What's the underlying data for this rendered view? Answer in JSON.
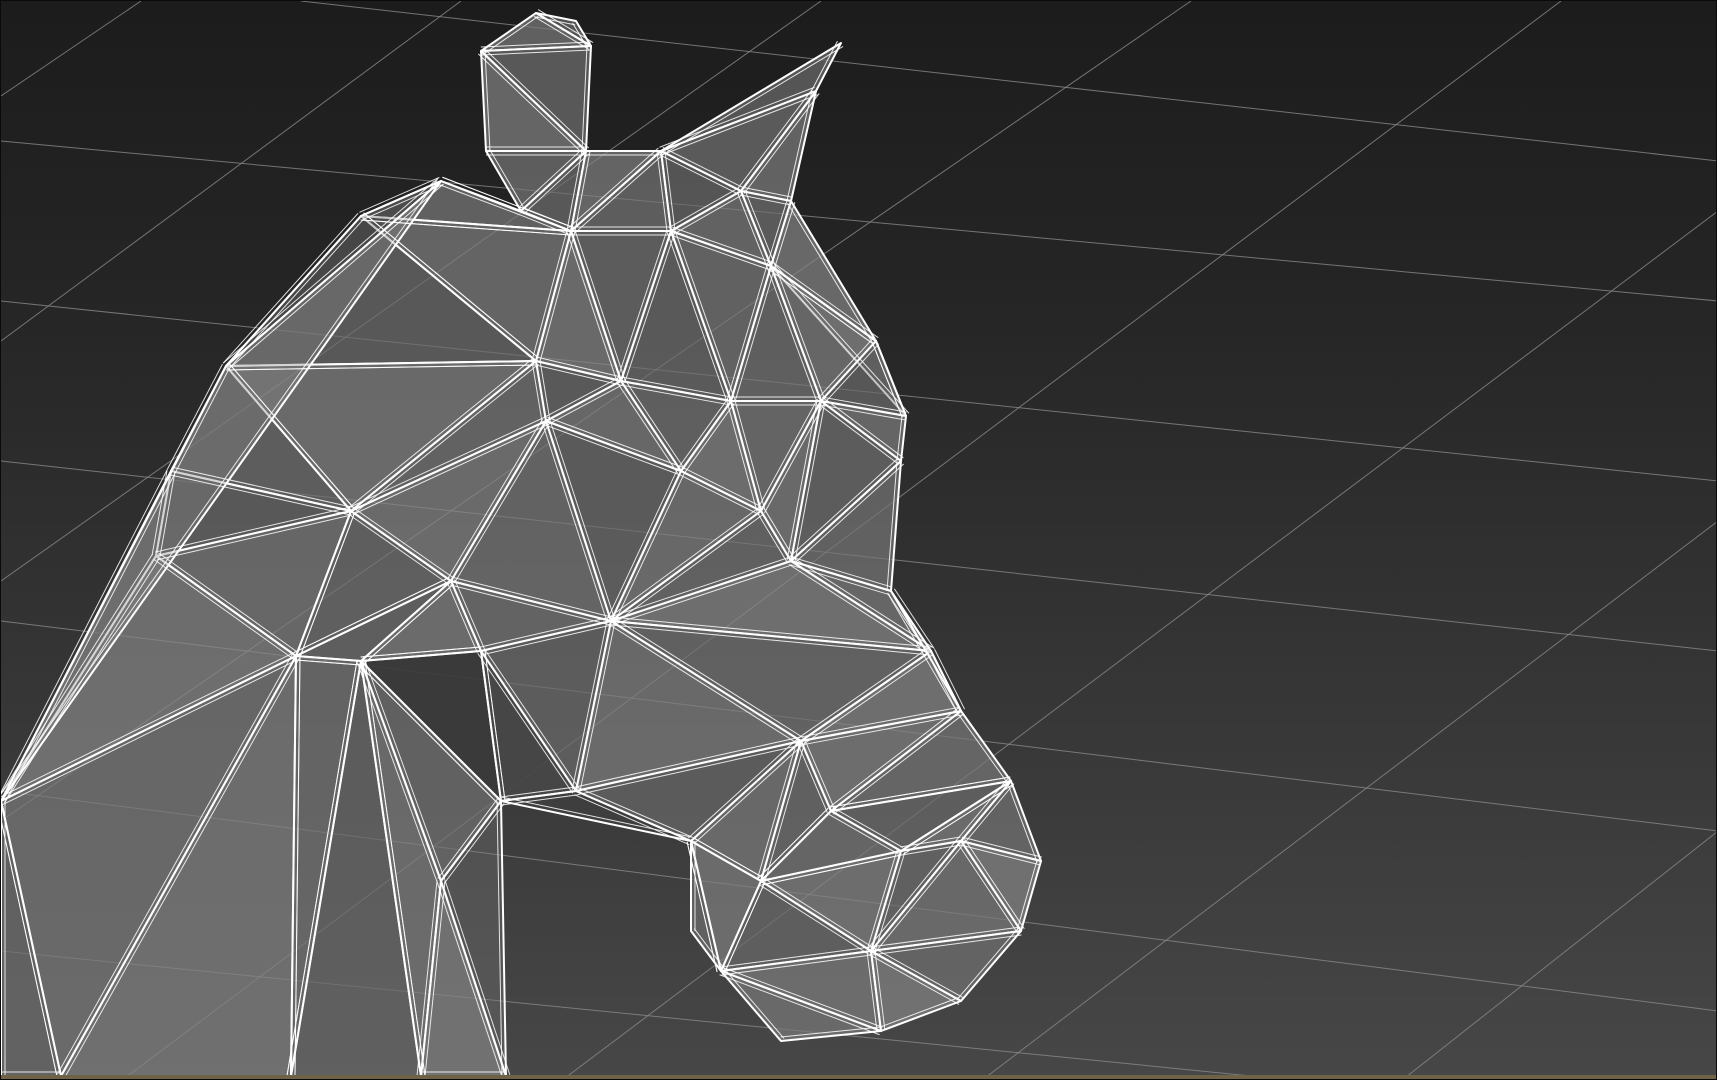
{
  "viewport": {
    "background_top": "#1c1c1c",
    "background_bottom": "#474747",
    "grid_color": "#8a8a8a",
    "wire_color": "#ffffff",
    "shade_color": "#7a7a7a",
    "shadow_color": "#111111",
    "bottom_border_color": "#6e6247"
  },
  "model": {
    "name_icon": "horse-head-wireframe",
    "display_mode": "wireframe-on-shaded"
  }
}
